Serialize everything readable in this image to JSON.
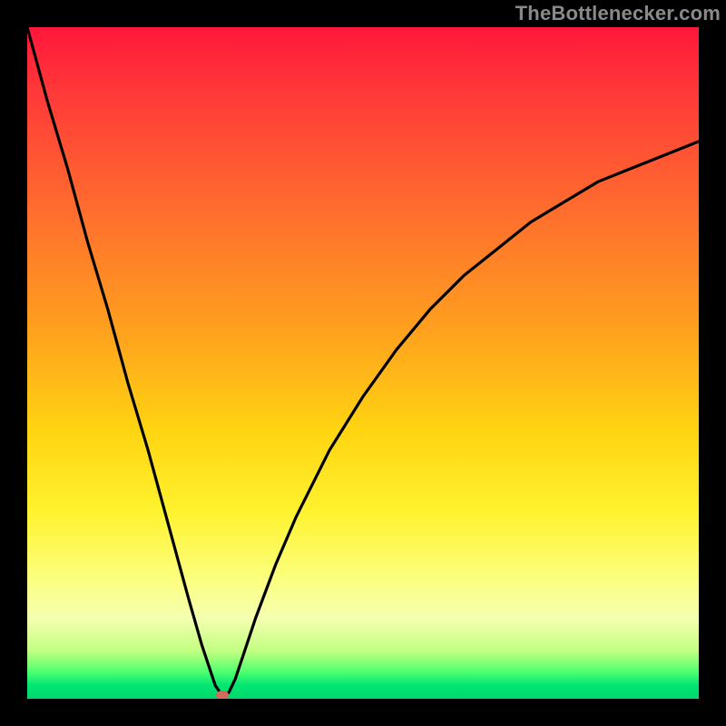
{
  "watermark": "TheBottlenecker.com",
  "chart_data": {
    "type": "line",
    "title": "",
    "xlabel": "",
    "ylabel": "",
    "xlim": [
      0,
      100
    ],
    "ylim": [
      0,
      100
    ],
    "note": "V-shaped bottleneck curve. X is a normalized independent variable (0–100); Y is bottleneck percentage (0%–100%). Minimum at x≈29. Gradient background encodes bottleneck severity: green (low) at bottom to red (high) at top. Values estimated from pixel positions as no axis ticks are shown.",
    "series": [
      {
        "name": "bottleneck-curve",
        "x": [
          0,
          3,
          6,
          9,
          12,
          15,
          18,
          21,
          24,
          26,
          27,
          28,
          29,
          30,
          31,
          32,
          34,
          37,
          40,
          45,
          50,
          55,
          60,
          65,
          70,
          75,
          80,
          85,
          90,
          95,
          100
        ],
        "y": [
          100,
          89,
          79,
          68,
          58,
          47,
          37,
          26,
          15,
          8,
          5,
          2,
          0.5,
          0.9,
          3,
          6,
          12,
          20,
          27,
          37,
          45,
          52,
          58,
          63,
          67,
          71,
          74,
          77,
          79,
          81,
          83
        ]
      }
    ],
    "minimum_marker": {
      "x": 29,
      "y": 0.5,
      "color": "#d46a5a"
    },
    "gradient_stops": [
      {
        "pct": 0,
        "color": "#ff173a"
      },
      {
        "pct": 28,
        "color": "#ff6f2d"
      },
      {
        "pct": 60,
        "color": "#ffd411"
      },
      {
        "pct": 82,
        "color": "#fcff7d"
      },
      {
        "pct": 96,
        "color": "#4fff70"
      },
      {
        "pct": 100,
        "color": "#00d86a"
      }
    ]
  }
}
